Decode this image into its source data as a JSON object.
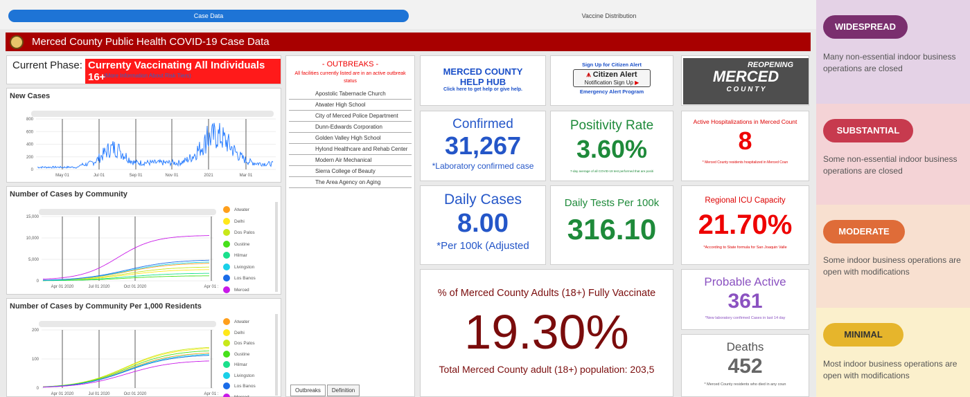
{
  "tabs": {
    "case_data": "Case Data",
    "vaccine_distribution": "Vaccine Distribution"
  },
  "header": {
    "title": "Merced County Public Health COVID-19 Case Data"
  },
  "phase": {
    "label": "Current Phase:",
    "value": "Currenty Vaccinating All Individuals 16+",
    "more": "(More Information About Risk Tiers)"
  },
  "new_cases": {
    "title": "New Cases",
    "yticks": [
      "800",
      "600",
      "400",
      "200",
      "0"
    ],
    "xticks": [
      "May 01",
      "Jul 01",
      "Sep 01",
      "Nov 01",
      "2021",
      "Mar 01"
    ]
  },
  "community": {
    "title": "Number of Cases by Community",
    "yticks": [
      "15,000",
      "10,000",
      "5,000",
      "0"
    ],
    "xticks": [
      "Apr 01 2020",
      "Jul 01 2020",
      "Oct 01 2020",
      "Apr 01 :"
    ]
  },
  "community_per1000": {
    "title": "Number of Cases by Community Per 1,000 Residents",
    "yticks": [
      "200",
      "100",
      "0"
    ],
    "xticks": [
      "Apr 01 2020",
      "Jul 01 2020",
      "Oct 01 2020",
      "Apr 01 :"
    ]
  },
  "legend": [
    {
      "name": "Atwater",
      "color": "#ff9f1c"
    },
    {
      "name": "Delhi",
      "color": "#ffe81a"
    },
    {
      "name": "Dos Palos",
      "color": "#c8e81a"
    },
    {
      "name": "Gustine",
      "color": "#46e01a"
    },
    {
      "name": "Hilmar",
      "color": "#1ae08c"
    },
    {
      "name": "Livingston",
      "color": "#1ad0e8"
    },
    {
      "name": "Los Banos",
      "color": "#1a6ce8"
    },
    {
      "name": "Merced",
      "color": "#c81ae8"
    }
  ],
  "outbreaks": {
    "title": "- OUTBREAKS -",
    "subtitle": "All facilities currently listed are in an active outbreak status",
    "items": [
      "Apostolic Tabernacle Church",
      "Atwater High School",
      "City of Merced Police Department",
      "Dunn-Edwards Corporation",
      "Golden Valley High School",
      "Hylond Healthcare and Rehab Center",
      "Modern Air Mechanical",
      "Sierra College of Beauty",
      "The Area Agency on Aging"
    ],
    "tab_outbreaks": "Outbreaks",
    "tab_definition": "Definition"
  },
  "helphub": {
    "line1": "MERCED COUNTY",
    "line2": "HELP HUB",
    "sub": "Click here to get help or give help."
  },
  "citizen": {
    "top": "Sign Up for Citizen Alert",
    "big": "Citizen Alert",
    "mid": "Notification Sign Up",
    "bottom": "Emergency Alert Program"
  },
  "reopening": {
    "top": "REOPENING",
    "mid": "MERCED",
    "bottom": "C O U N T Y"
  },
  "confirmed": {
    "title": "Confirmed",
    "value": "31,267",
    "note": "*Laboratory confirmed case"
  },
  "positivity": {
    "title": "Positivity Rate",
    "value": "3.60%",
    "note": "7-day average of all COVID-19 test performed that are positi"
  },
  "hospital": {
    "title": "Active Hospitalizations in Merced Count",
    "value": "8",
    "note": "* Merced County residents hospitalized in Merced Coun"
  },
  "daily_cases": {
    "title": "Daily Cases",
    "value": "8.00",
    "note": "*Per 100k (Adjusted"
  },
  "daily_tests": {
    "title": "Daily Tests Per 100k",
    "value": "316.10"
  },
  "icu": {
    "title": "Regional ICU Capacity",
    "value": "21.70%",
    "note": "*According to State formula for San Joaquin Valle"
  },
  "vaccinated": {
    "title": "% of Merced County Adults (18+) Fully Vaccinate",
    "value": "19.30%",
    "note": "Total Merced County adult (18+) population: 203,5"
  },
  "probable": {
    "title": "Probable Active",
    "value": "361",
    "note": "*New laboratory confirmed Cases in last 14 day"
  },
  "deaths": {
    "title": "Deaths",
    "value": "452",
    "note": "* Merced County residents who died in any coun"
  },
  "tiers": [
    {
      "label": "WIDESPREAD",
      "desc": "Many non-essential indoor business operations are closed",
      "color": "#7a2f6e",
      "bg": "#e4d2e6"
    },
    {
      "label": "SUBSTANTIAL",
      "desc": "Some non-essential indoor business operations are closed",
      "color": "#c73a4e",
      "bg": "#f4d3d6"
    },
    {
      "label": "MODERATE",
      "desc": "Some indoor business operations are open with modifications",
      "color": "#df6c38",
      "bg": "#f8e0d0"
    },
    {
      "label": "MINIMAL",
      "desc": "Most indoor business operations are open with modifications",
      "color": "#e6b52c",
      "bg": "#fbf0cc"
    }
  ]
}
